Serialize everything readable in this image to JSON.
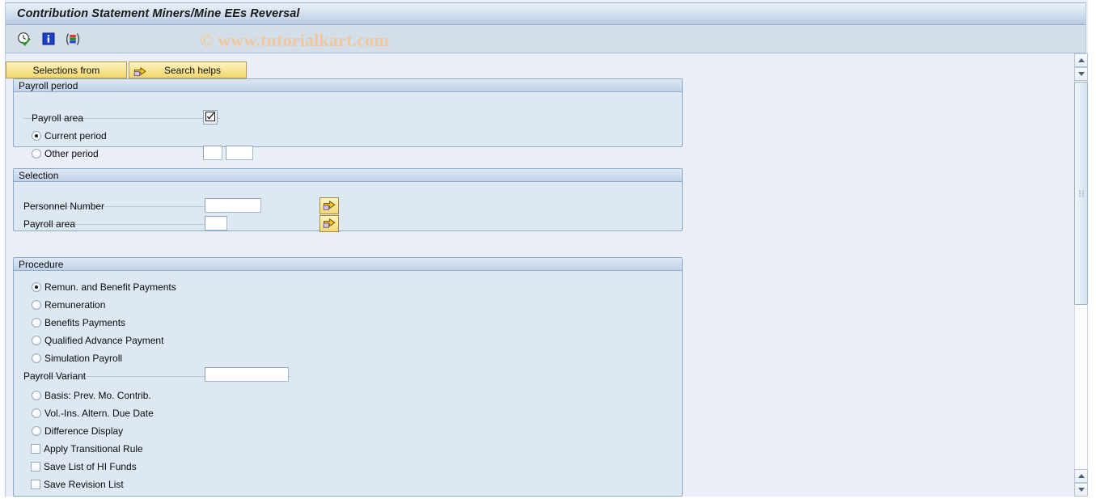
{
  "window": {
    "title": "Contribution Statement Miners/Mine EEs Reversal",
    "watermark": "© www.tutorialkart.com"
  },
  "toolbar": {
    "icons": [
      {
        "name": "execute-clock-icon",
        "tooltip": "Execute"
      },
      {
        "name": "information-icon",
        "tooltip": "Information"
      },
      {
        "name": "variant-icon",
        "tooltip": "Get Variant"
      }
    ]
  },
  "tabs": [
    {
      "label": "Selections from",
      "icon": "",
      "selected": true
    },
    {
      "label": "Search helps",
      "icon": "arrow-folder-icon",
      "selected": false
    }
  ],
  "sections": {
    "payroll_period": {
      "header": "Payroll period",
      "payroll_area_label": "Payroll area",
      "payroll_area_button_icon": "checkbox-check-icon",
      "options": [
        {
          "label": "Current period",
          "selected": true
        },
        {
          "label": "Other period",
          "selected": false
        }
      ],
      "other_period_value_1": "",
      "other_period_value_2": ""
    },
    "selection": {
      "header": "Selection",
      "fields": [
        {
          "label": "Personnel Number",
          "value": "",
          "help_icon": "multiple-selection-icon"
        },
        {
          "label": "Payroll area",
          "value": "",
          "help_icon": "multiple-selection-icon"
        }
      ]
    },
    "procedure": {
      "header": "Procedure",
      "radios_top": [
        {
          "label": "Remun. and Benefit Payments",
          "selected": true
        },
        {
          "label": "Remuneration",
          "selected": false
        },
        {
          "label": "Benefits Payments",
          "selected": false
        },
        {
          "label": "Qualified Advance Payment",
          "selected": false
        },
        {
          "label": "Simulation Payroll",
          "selected": false
        }
      ],
      "payroll_variant_label": "Payroll Variant",
      "payroll_variant_value": "",
      "radios_bottom": [
        {
          "label": "Basis: Prev. Mo. Contrib.",
          "selected": false
        },
        {
          "label": "Vol.-Ins. Altern. Due Date",
          "selected": false
        },
        {
          "label": "Difference Display",
          "selected": false
        }
      ],
      "checkboxes": [
        {
          "label": "Apply Transitional Rule",
          "checked": false
        },
        {
          "label": "Save List of HI Funds",
          "checked": false
        },
        {
          "label": "Save Revision List",
          "checked": false
        }
      ]
    }
  },
  "scrollbar": {
    "up_icon": "arrow-up-icon",
    "down_icon": "arrow-down-icon",
    "grip_icon": "scroll-grip-icon"
  },
  "colors": {
    "title_bar_accent": "#b5c9e0",
    "tab_yellow": "#f5dd7e",
    "panel_body": "#dee8f3",
    "canvas": "#eaeff7",
    "watermark": "#eec9a0"
  }
}
